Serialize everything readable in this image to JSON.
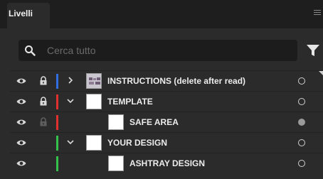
{
  "panel": {
    "tab_label": "Livelli"
  },
  "search": {
    "placeholder": "Cerca tutto"
  },
  "layers": [
    {
      "name": "INSTRUCTIONS (delete after read)",
      "color": "#2f6fe0",
      "locked": true,
      "expandable": true,
      "expanded": false,
      "target": "empty"
    },
    {
      "name": "TEMPLATE",
      "color": "#e0312f",
      "locked": true,
      "expandable": true,
      "expanded": true,
      "target": "empty"
    },
    {
      "name": "SAFE AREA",
      "color": "#e0312f",
      "locked": true,
      "lock_dim": true,
      "expandable": false,
      "target": "filled"
    },
    {
      "name": "YOUR DESIGN",
      "color": "#35c24a",
      "locked": false,
      "expandable": true,
      "expanded": true,
      "target": "empty"
    },
    {
      "name": "ASHTRAY DESIGN",
      "color": "#35c24a",
      "locked": false,
      "expandable": false,
      "target": "empty"
    }
  ]
}
